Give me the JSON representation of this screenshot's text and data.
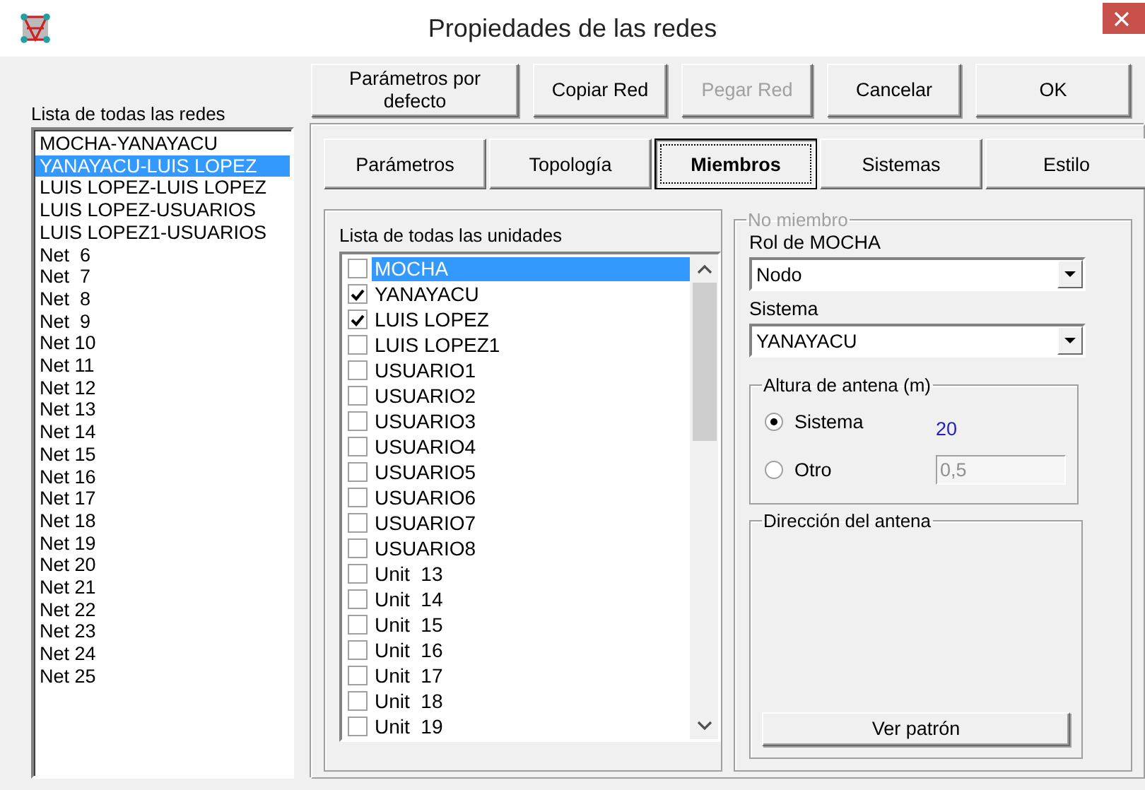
{
  "window": {
    "title": "Propiedades de las redes"
  },
  "networks": {
    "label": "Lista de todas las redes",
    "items": [
      {
        "name": "MOCHA-YANAYACU",
        "selected": false
      },
      {
        "name": "YANAYACU-LUIS LOPEZ",
        "selected": true
      },
      {
        "name": "LUIS LOPEZ-LUIS LOPEZ",
        "selected": false
      },
      {
        "name": "LUIS LOPEZ-USUARIOS",
        "selected": false
      },
      {
        "name": "LUIS LOPEZ1-USUARIOS",
        "selected": false
      },
      {
        "name": "Net  6",
        "selected": false
      },
      {
        "name": "Net  7",
        "selected": false
      },
      {
        "name": "Net  8",
        "selected": false
      },
      {
        "name": "Net  9",
        "selected": false
      },
      {
        "name": "Net 10",
        "selected": false
      },
      {
        "name": "Net 11",
        "selected": false
      },
      {
        "name": "Net 12",
        "selected": false
      },
      {
        "name": "Net 13",
        "selected": false
      },
      {
        "name": "Net 14",
        "selected": false
      },
      {
        "name": "Net 15",
        "selected": false
      },
      {
        "name": "Net 16",
        "selected": false
      },
      {
        "name": "Net 17",
        "selected": false
      },
      {
        "name": "Net 18",
        "selected": false
      },
      {
        "name": "Net 19",
        "selected": false
      },
      {
        "name": "Net 20",
        "selected": false
      },
      {
        "name": "Net 21",
        "selected": false
      },
      {
        "name": "Net 22",
        "selected": false
      },
      {
        "name": "Net 23",
        "selected": false
      },
      {
        "name": "Net 24",
        "selected": false
      },
      {
        "name": "Net 25",
        "selected": false
      }
    ]
  },
  "buttons": [
    {
      "label": "Parámetros por defecto",
      "disabled": false
    },
    {
      "label": "Copiar Red",
      "disabled": false
    },
    {
      "label": "Pegar Red",
      "disabled": true
    },
    {
      "label": "Cancelar",
      "disabled": false
    },
    {
      "label": "OK",
      "disabled": false
    }
  ],
  "tabs": [
    {
      "label": "Parámetros",
      "selected": false
    },
    {
      "label": "Topología",
      "selected": false
    },
    {
      "label": "Miembros",
      "selected": true
    },
    {
      "label": "Sistemas",
      "selected": false
    },
    {
      "label": "Estilo",
      "selected": false
    }
  ],
  "units": {
    "label": "Lista de todas las unidades",
    "items": [
      {
        "name": "MOCHA",
        "checked": false,
        "selected": true
      },
      {
        "name": "YANAYACU",
        "checked": true,
        "selected": false
      },
      {
        "name": "LUIS LOPEZ",
        "checked": true,
        "selected": false
      },
      {
        "name": "LUIS LOPEZ1",
        "checked": false,
        "selected": false
      },
      {
        "name": "USUARIO1",
        "checked": false,
        "selected": false
      },
      {
        "name": "USUARIO2",
        "checked": false,
        "selected": false
      },
      {
        "name": "USUARIO3",
        "checked": false,
        "selected": false
      },
      {
        "name": "USUARIO4",
        "checked": false,
        "selected": false
      },
      {
        "name": "USUARIO5",
        "checked": false,
        "selected": false
      },
      {
        "name": "USUARIO6",
        "checked": false,
        "selected": false
      },
      {
        "name": "USUARIO7",
        "checked": false,
        "selected": false
      },
      {
        "name": "USUARIO8",
        "checked": false,
        "selected": false
      },
      {
        "name": "Unit  13",
        "checked": false,
        "selected": false
      },
      {
        "name": "Unit  14",
        "checked": false,
        "selected": false
      },
      {
        "name": "Unit  15",
        "checked": false,
        "selected": false
      },
      {
        "name": "Unit  16",
        "checked": false,
        "selected": false
      },
      {
        "name": "Unit  17",
        "checked": false,
        "selected": false
      },
      {
        "name": "Unit  18",
        "checked": false,
        "selected": false
      },
      {
        "name": "Unit  19",
        "checked": false,
        "selected": false
      }
    ]
  },
  "member": {
    "title": "No miembro",
    "disabled": true,
    "role_label": "Rol de MOCHA",
    "role_value": "Nodo",
    "system_label": "Sistema",
    "system_value": "YANAYACU",
    "antenna_height": {
      "title": "Altura de antena (m)",
      "options": [
        {
          "label": "Sistema",
          "selected": true,
          "value": "20"
        },
        {
          "label": "Otro",
          "selected": false,
          "value": "0,5"
        }
      ]
    },
    "direction": {
      "title": "Dirección del antena",
      "button": "Ver patrón"
    }
  }
}
